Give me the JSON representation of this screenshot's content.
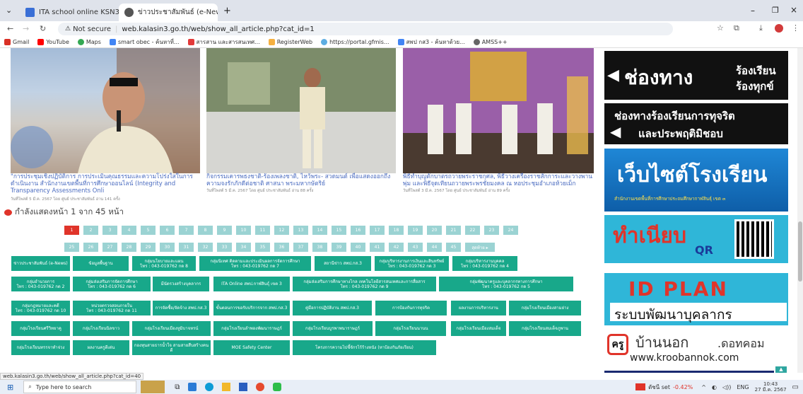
{
  "browser": {
    "tabs": [
      {
        "title": "ITA school online KSN3"
      },
      {
        "title": "ข่าวประชาสัมพันธ์ (e-News) - สำนั"
      }
    ],
    "not_secure": "Not secure",
    "url": "web.kalasin3.go.th/web/show_all_article.php?cat_id=1",
    "bookmarks": [
      "Gmail",
      "YouTube",
      "Maps",
      "smart obec - ค้นหาที่...",
      "สารสาน และสารสนเทศ...",
      "RegisterWeb",
      "https://portal.gfmis...",
      "สพป กส3 - ค้นหาด้วย...",
      "AMSS++"
    ]
  },
  "articles": [
    {
      "title": "\"การประชุมเชิงปฏิบัติการ การประเมินคุณธรรมและความโปร่งใสในการดำเนินงาน สำนักงานเขตพื้นที่การศึกษาออนไลน์ (Integrity and Transparency Assessments Onli",
      "meta": "วันที่โพสต์ 5 มี.ค. 2567 โดย ศูนย์ ประชาสัมพันธ์ อ่าน 141 ครั้ง"
    },
    {
      "title": "กิจกรรมเคารพธงชาติ-ร้องเพลงชาติ, ไหว้พระ- สวดมนต์ เพื่อแสดงออกถึงความจงรักภักดีต่อชาติ ศาสนา พระมหากษัตริย์",
      "meta": "วันที่โพสต์ 5 มี.ค. 2567 โดย ศูนย์ ประชาสัมพันธ์ อ่าน 88 ครั้ง"
    },
    {
      "title": "พิธีทำบุญตักบาตรถวายพระราชกุศล, พิธีวางเครื่องราชสักการะและวางพานพุ่ม และพิธีจุดเทียนถวายพระพรชัยมงคล ณ หอประชุมอำเภอห้วยเม็ก",
      "meta": "วันที่โพสต์ 3 มี.ค. 2567 โดย ศูนย์ ประชาสัมพันธ์ อ่าน 89 ครั้ง"
    }
  ],
  "pagination": {
    "heading": "กำลังแสดงหน้า 1 จาก 45 หน้า",
    "row1": [
      "1",
      "2",
      "3",
      "4",
      "5",
      "6",
      "7",
      "8",
      "9",
      "10",
      "11",
      "12",
      "13",
      "14",
      "15",
      "16",
      "17",
      "18",
      "19",
      "20",
      "21",
      "22",
      "23",
      "24"
    ],
    "row2": [
      "25",
      "26",
      "27",
      "28",
      "29",
      "30",
      "31",
      "32",
      "33",
      "34",
      "35",
      "36",
      "37",
      "38",
      "39",
      "40",
      "41",
      "42",
      "43",
      "44",
      "45"
    ],
    "last": "สุดท้าย"
  },
  "categories": [
    [
      "ข่าวประชาสัมพันธ์ (e-News)",
      "ข้อมูลพื้นฐาน",
      "กลุ่มนโยบายและแผน\nโทร : 043-019762 กด 8",
      "กลุ่มนิเทศ ติดตามและประเมินผลการจัดการศึกษา\nโทร : 043-019762 กด 7",
      "สถานีข่าว สพป.กส.3",
      "กลุ่มบริหารงานการเงินและสินทรัพย์\nโทร : 043-019762 กด 3",
      "กลุ่มบริหารงานบุคคล\nโทร : 043-019762 กด 4"
    ],
    [
      "กลุ่มอำนวยการ\nโทร : 043-019762 กด 2",
      "กลุ่มส่งเสริมการจัดการศึกษา\nโทร : 043-019762 กด 6",
      "มีนัดรวงสร้างบุคลากร",
      "ITA Online สพป.กาฬสินธุ์ เขต 3",
      "กลุ่มส่งเสริมการศึกษาทางไกล เทคโนโลยีสารสนเทศและการสื่อสาร\nโทร : 043-019762 กด 9",
      "กลุ่มพัฒนาครูและบุคลากรทางการศึกษา\nโทร : 043-019762 กด 5"
    ],
    [
      "กลุ่มกฎหมายและคดี\nโทร : 043-019762 กด 10",
      "หน่วยตรวจสอบภายใน\nโทร : 043-019762 กด 11",
      "การจัดซื้อ/จัดจ้าง สพป.กส.3",
      "ขั้นตอนการขอรับบริการจาก สพป.กส.3",
      "คู่มือการปฏิบัติงาน สพป.กส.3",
      "การป้องกันการทุจริต",
      "ผลงานการบริหารงาน",
      "กลุ่มโรงเรียนเมืองสามย่าง"
    ],
    [
      "กลุ่มโรงเรียนศรีวิทยาคู",
      "กลุ่มโรงเรียนนิลขาว",
      "กลุ่มโรงเรียนเมืองหูมิบาจหรน์",
      "กลุ่มโรงเรียนลำพองพัฒนาราษฎร์",
      "กลุ่มโรงเรียนบูรพาพนาราษฎร์",
      "กลุ่มโรงเรียนนานน",
      "กลุ่มโรงเรียนเมืองสมเด็จ",
      "กลุ่มโรงเรียนสมเด็จภูพาน"
    ],
    [
      "กลุ่มโรงเรียนทรรจาทำจ่วง",
      "ผลงานครูดีเด่น",
      "กองทุนสายธารน้ำใจ สามสายสืบสร้างคนดี",
      "MOE Safety Center",
      "โครงการความไปชี้จักรไร้ร้างหนัง (หาป้องกันภัยเรียน)"
    ]
  ],
  "banners": {
    "b1": [
      "ช่องทาง",
      "ร้องเรียน",
      "ร้องทุกข์"
    ],
    "b2": [
      "ช่องทางร้องเรียนการทุจริต",
      "และประพฤติมิชอบ"
    ],
    "b3": [
      "เว็บไซต์โรงเรียน",
      "สำนักงานเขตพื้นที่การศึกษาประถมศึกษากาฬสินธุ์ เขต ๓"
    ],
    "b4": [
      "ทำเนียบ",
      "QR"
    ],
    "b5": [
      "ID PLAN",
      "ระบบพัฒนาบุคลากร"
    ],
    "b6": [
      "ครู",
      "บ้านนอก",
      ".ดอทคอม",
      "www.kroobannok.com"
    ]
  },
  "status_url": "web.kalasin3.go.th/web/show_all_article.php?cat_id=40",
  "taskbar": {
    "search": "Type here to search",
    "stock": "ดัชนี set",
    "stock_change": "-0.42%",
    "lang": "ENG",
    "time": "10:43",
    "date": "27 มี.ค. 2567"
  },
  "colors": {
    "accent": "#18a88a",
    "current_page": "#e0342a",
    "page": "#9bd3d3"
  }
}
